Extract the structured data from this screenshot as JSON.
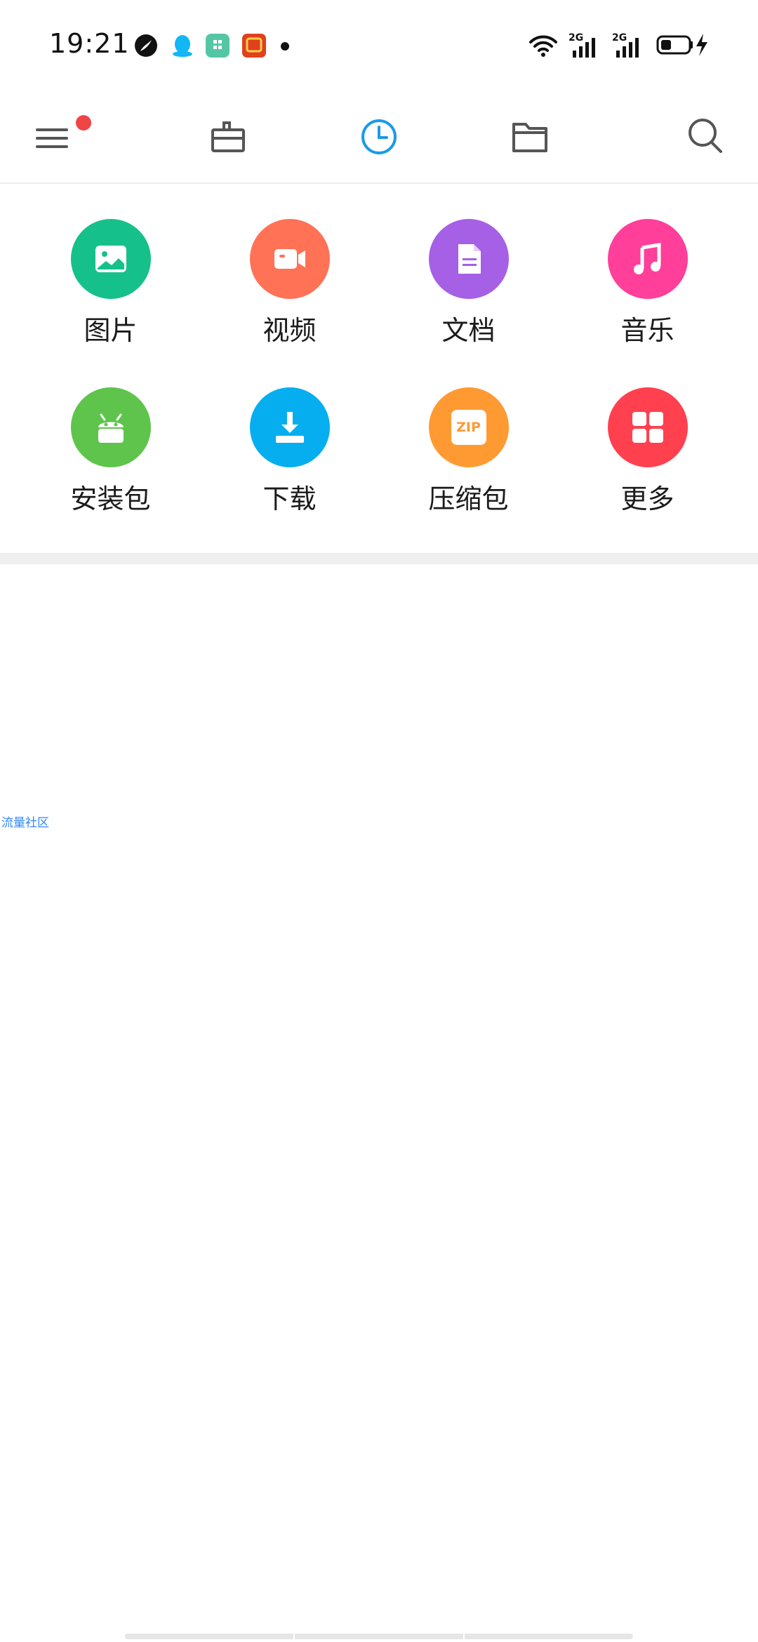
{
  "status_bar": {
    "time": "19:21",
    "app_icons": [
      "mercury-app-icon",
      "qq-icon",
      "mi-app-icon",
      "taobao-icon"
    ],
    "network_1": "2G",
    "network_2": "2G"
  },
  "toolbar": {
    "items": [
      "menu-icon",
      "toolbox-icon",
      "recent-clock-icon",
      "folder-icon",
      "search-icon"
    ],
    "active": "recent-clock-icon",
    "accent_color": "#1a9be6"
  },
  "categories": [
    {
      "label": "图片",
      "icon": "image-icon",
      "color": "#16c08b"
    },
    {
      "label": "视频",
      "icon": "video-icon",
      "color": "#ff7255"
    },
    {
      "label": "文档",
      "icon": "document-icon",
      "color": "#a560e6"
    },
    {
      "label": "音乐",
      "icon": "music-icon",
      "color": "#ff3f9a"
    },
    {
      "label": "安装包",
      "icon": "android-icon",
      "color": "#5ec44b"
    },
    {
      "label": "下载",
      "icon": "download-icon",
      "color": "#06aef0"
    },
    {
      "label": "压缩包",
      "icon": "zip-icon",
      "color": "#ff9a33",
      "badge_text": "ZIP"
    },
    {
      "label": "更多",
      "icon": "more-grid-icon",
      "color": "#ff404f"
    }
  ],
  "link_text": "流量社区"
}
